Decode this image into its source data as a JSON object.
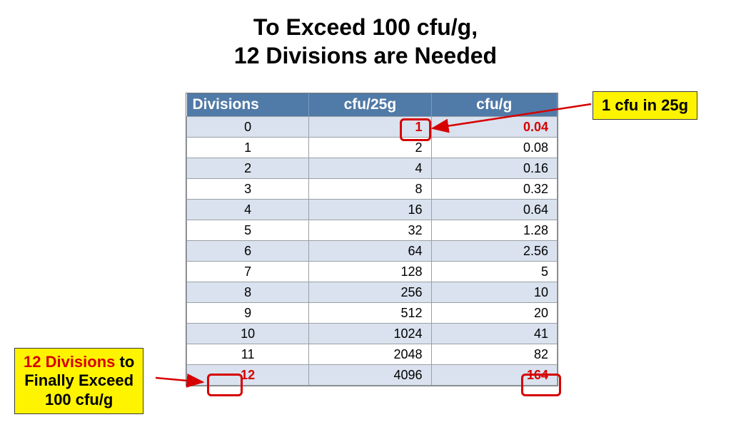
{
  "title_line1": "To Exceed 100 cfu/g,",
  "title_line2": "12 Divisions are Needed",
  "headers": {
    "c1": "Divisions",
    "c2": "cfu/25g",
    "c3": "cfu/g"
  },
  "rows": [
    {
      "div": "0",
      "cfu25": "1",
      "cfug": "0.04"
    },
    {
      "div": "1",
      "cfu25": "2",
      "cfug": "0.08"
    },
    {
      "div": "2",
      "cfu25": "4",
      "cfug": "0.16"
    },
    {
      "div": "3",
      "cfu25": "8",
      "cfug": "0.32"
    },
    {
      "div": "4",
      "cfu25": "16",
      "cfug": "0.64"
    },
    {
      "div": "5",
      "cfu25": "32",
      "cfug": "1.28"
    },
    {
      "div": "6",
      "cfu25": "64",
      "cfug": "2.56"
    },
    {
      "div": "7",
      "cfu25": "128",
      "cfug": "5"
    },
    {
      "div": "8",
      "cfu25": "256",
      "cfug": "10"
    },
    {
      "div": "9",
      "cfu25": "512",
      "cfug": "20"
    },
    {
      "div": "10",
      "cfu25": "1024",
      "cfug": "41"
    },
    {
      "div": "11",
      "cfu25": "2048",
      "cfug": "82"
    },
    {
      "div": "12",
      "cfu25": "4096",
      "cfug": "164"
    }
  ],
  "callouts": {
    "top_right": "1 cfu in 25g",
    "bottom_left_l1_red": "12 Divisions",
    "bottom_left_l1_black": " to",
    "bottom_left_l2": "Finally Exceed",
    "bottom_left_l3": "100 cfu/g"
  },
  "highlight": {
    "first_row_red": true,
    "last_row_div_red": true,
    "last_row_cfug_red": true
  },
  "colors": {
    "header_bg": "#507aa7",
    "row_alt_bg": "#d9e2ee",
    "highlight_red": "#d60000",
    "callout_yellow": "#fff400"
  },
  "chart_data": {
    "type": "table",
    "title": "To Exceed 100 cfu/g, 12 Divisions are Needed",
    "columns": [
      "Divisions",
      "cfu/25g",
      "cfu/g"
    ],
    "data": [
      [
        0,
        1,
        0.04
      ],
      [
        1,
        2,
        0.08
      ],
      [
        2,
        4,
        0.16
      ],
      [
        3,
        8,
        0.32
      ],
      [
        4,
        16,
        0.64
      ],
      [
        5,
        32,
        1.28
      ],
      [
        6,
        64,
        2.56
      ],
      [
        7,
        128,
        5
      ],
      [
        8,
        256,
        10
      ],
      [
        9,
        512,
        20
      ],
      [
        10,
        1024,
        41
      ],
      [
        11,
        2048,
        82
      ],
      [
        12,
        4096,
        164
      ]
    ],
    "annotations": [
      {
        "text": "1 cfu in 25g",
        "points_to": "row 0, cfu/25g = 1"
      },
      {
        "text": "12 Divisions to Finally Exceed 100 cfu/g",
        "points_to": "row 12, Divisions = 12, cfu/g = 164"
      }
    ]
  }
}
